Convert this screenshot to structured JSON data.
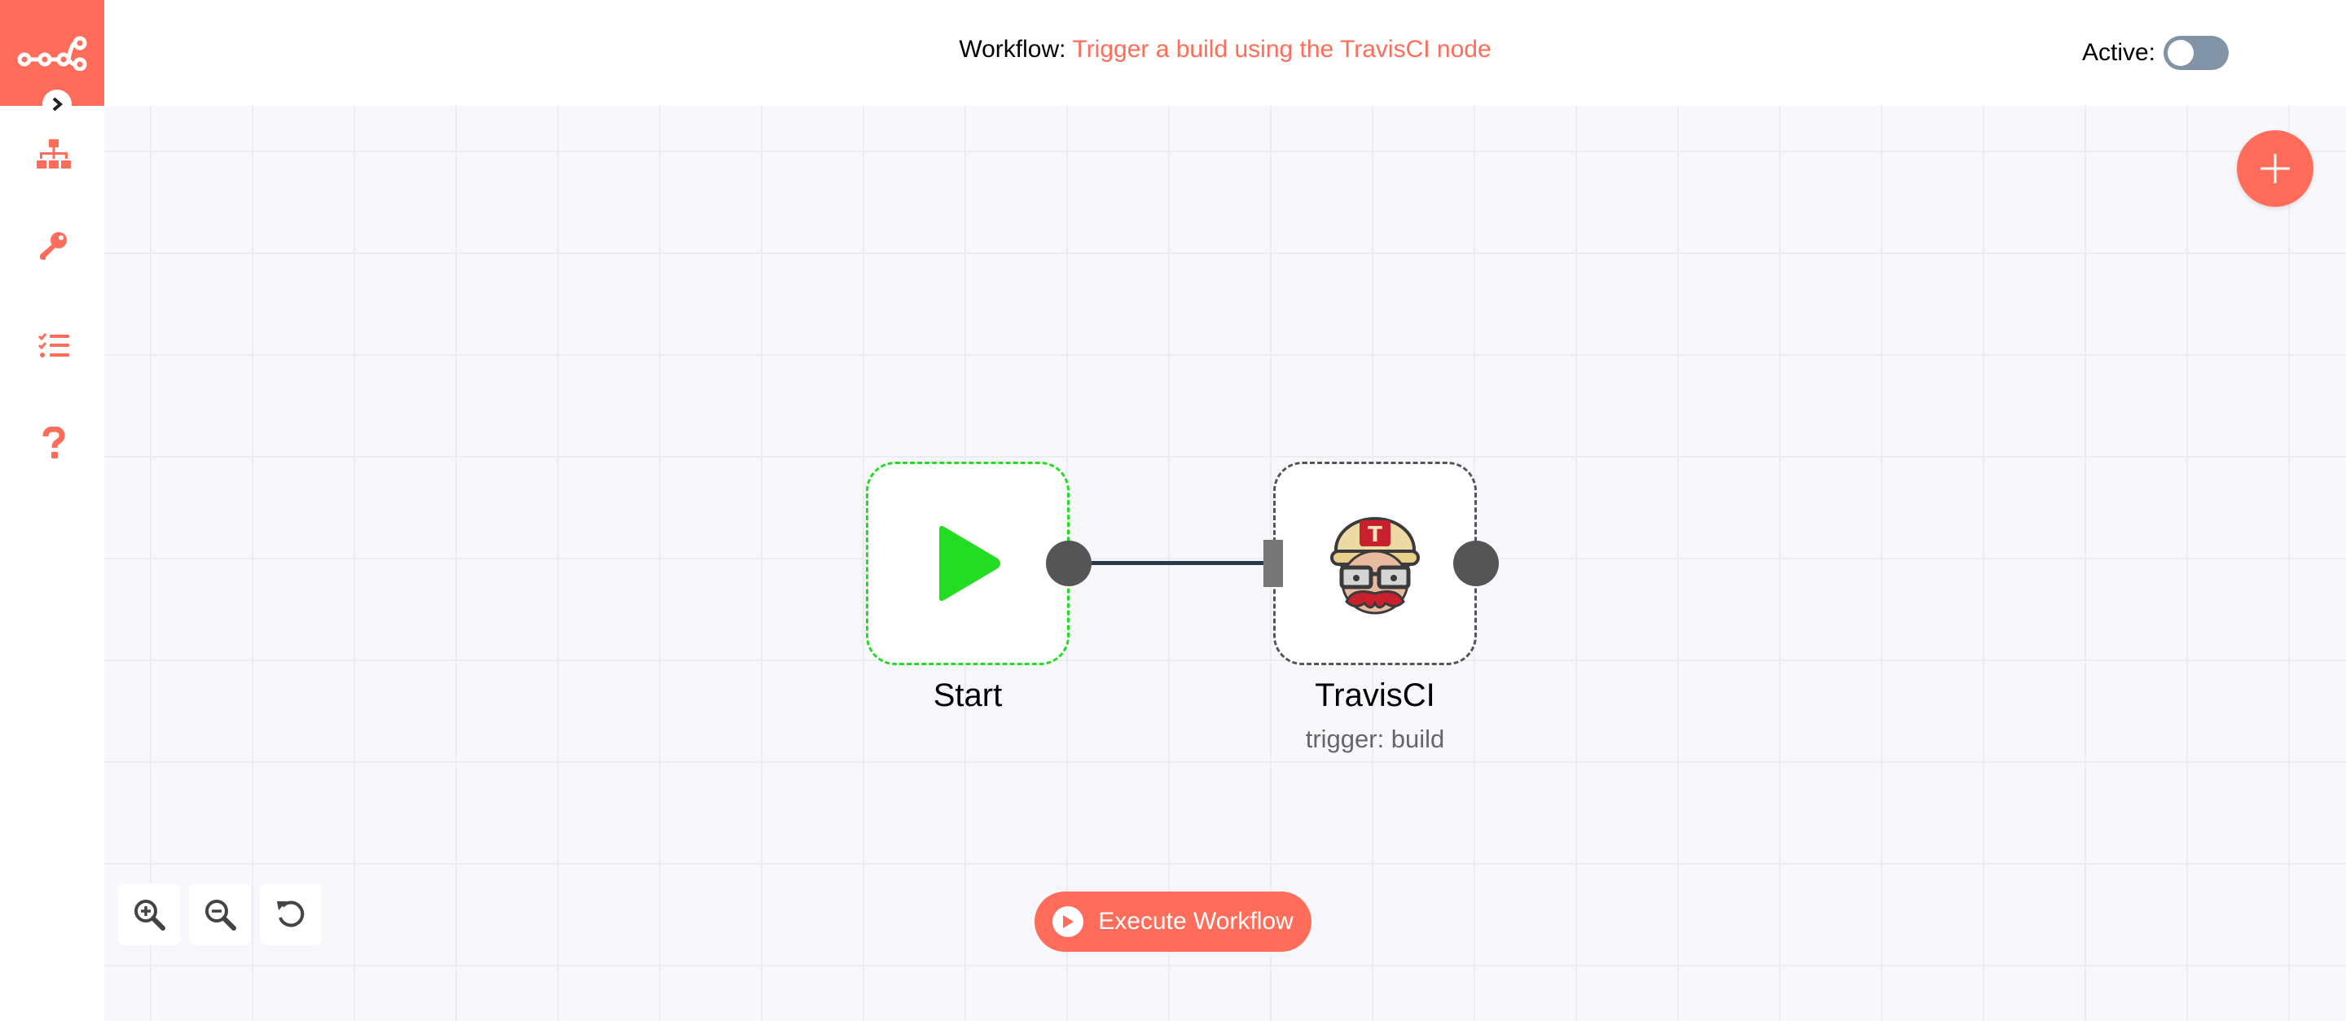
{
  "header": {
    "workflow_label": "Workflow:",
    "workflow_name": "Trigger a build using the TravisCI node",
    "active_label": "Active:",
    "active": false
  },
  "sidebar": {
    "logo_icon": "n8n-logo-icon",
    "items": [
      {
        "icon": "workflows-icon"
      },
      {
        "icon": "key-icon"
      },
      {
        "icon": "executions-list-icon"
      },
      {
        "icon": "help-icon"
      }
    ]
  },
  "nodes": [
    {
      "name": "Start",
      "icon": "play-icon",
      "color": "#22dd22"
    },
    {
      "name": "TravisCI",
      "subtitle": "trigger: build",
      "icon": "travisci-icon"
    }
  ],
  "toolbar": {
    "execute_label": "Execute Workflow",
    "zoom_in_icon": "zoom-in-icon",
    "zoom_out_icon": "zoom-out-icon",
    "reset_icon": "reset-zoom-icon"
  },
  "colors": {
    "accent": "#ff6d5a",
    "canvas_bg": "#f8f8fc",
    "grid": "#ececf4",
    "toggle_off": "#8193a6",
    "start_green": "#22dd22"
  }
}
